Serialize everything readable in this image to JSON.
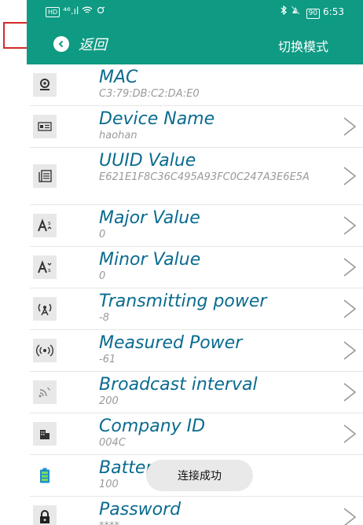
{
  "status_bar": {
    "hd": "HD",
    "network": "⁴⁶.ıl",
    "wifi_icon": "wifi-icon",
    "battery": "90",
    "time": "6:53"
  },
  "app_bar": {
    "back_icon": "chevron-left-icon",
    "back_label": "返回",
    "mode_label": "切换模式"
  },
  "items": [
    {
      "title": "MAC",
      "value": "C3:79:DB:C2:DA:E0",
      "icon": "location-pin-icon",
      "chevron": false
    },
    {
      "title": "Device Name",
      "value": "haohan",
      "icon": "id-card-icon",
      "chevron": true
    },
    {
      "title": "UUID Value",
      "value": "E621E1F8C36C495A93FC0C247A3E6E5A",
      "icon": "document-icon",
      "chevron": true
    },
    {
      "title": "Major Value",
      "value": "0",
      "icon": "text-size-up-icon",
      "chevron": true
    },
    {
      "title": "Minor Value",
      "value": "0",
      "icon": "text-size-down-icon",
      "chevron": true
    },
    {
      "title": "Transmitting power",
      "value": "-8",
      "icon": "antenna-icon",
      "chevron": true
    },
    {
      "title": "Measured Power",
      "value": "-61",
      "icon": "signal-waves-icon",
      "chevron": true
    },
    {
      "title": "Broadcast interval",
      "value": "200",
      "icon": "broadcast-icon",
      "chevron": true
    },
    {
      "title": "Company ID",
      "value": "004C",
      "icon": "building-icon",
      "chevron": true
    },
    {
      "title": "Battery",
      "value": "100",
      "icon": "battery-icon",
      "chevron": false
    },
    {
      "title": "Password",
      "value": "****",
      "icon": "lock-icon",
      "chevron": true
    }
  ],
  "toast": "连接成功",
  "colors": {
    "primary": "#0f9a83",
    "title": "#0a6b8f",
    "annotation": "#d22a2a"
  }
}
